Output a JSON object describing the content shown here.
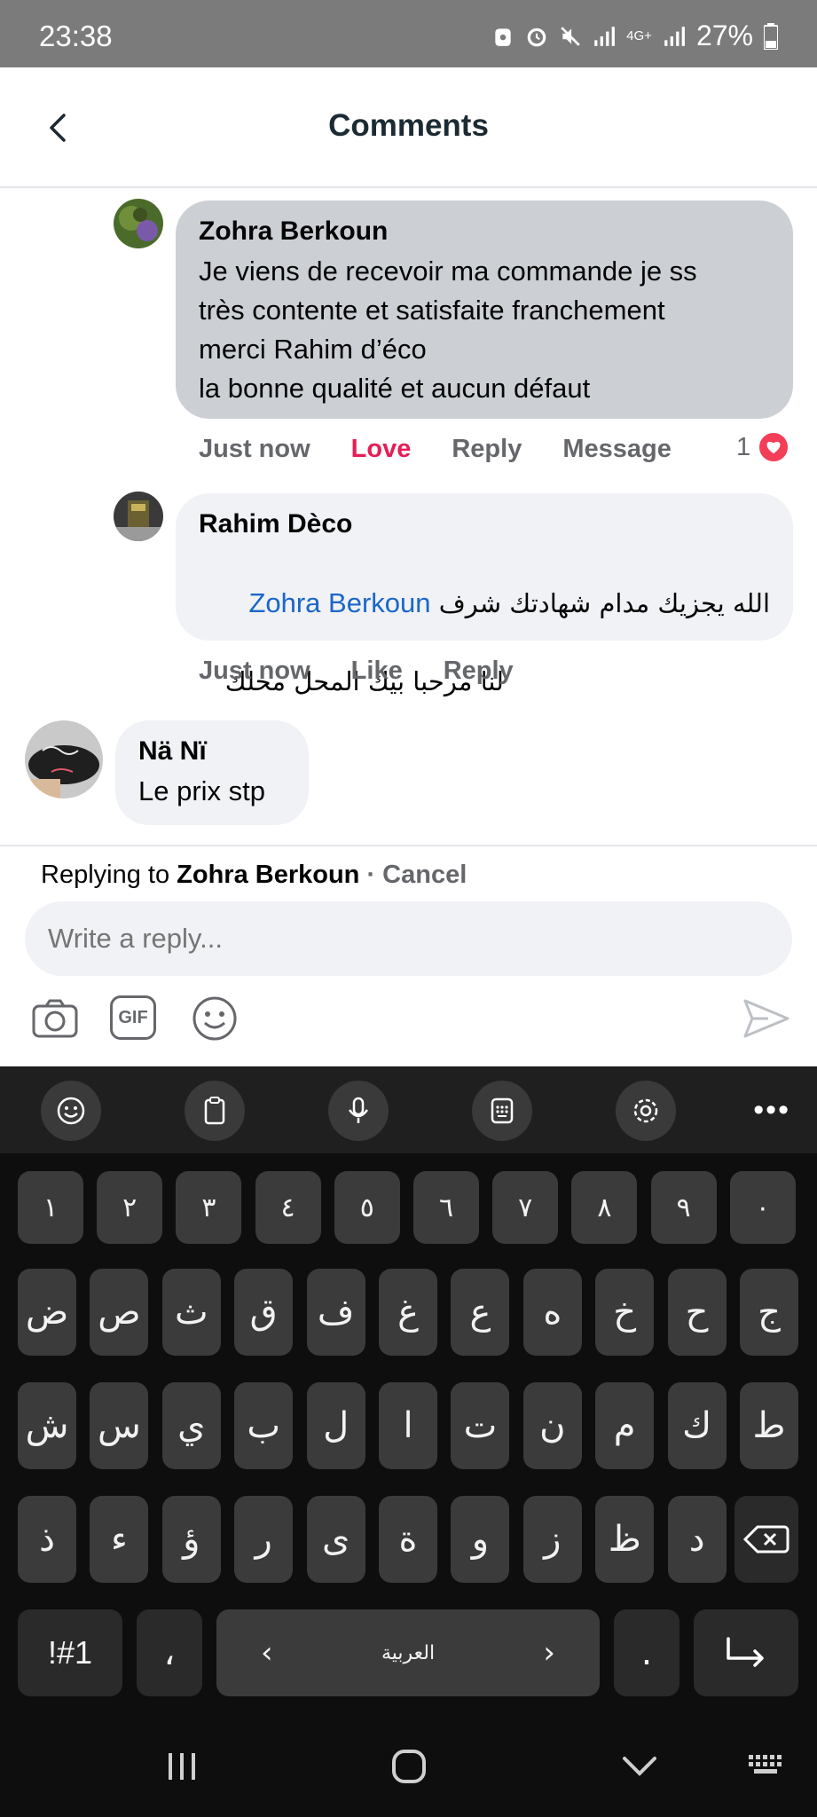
{
  "status_bar": {
    "time": "23:38",
    "network": "4G+",
    "battery": "27%"
  },
  "header": {
    "title": "Comments"
  },
  "comments": [
    {
      "author": "Zohra Berkoun",
      "text": "Je viens de recevoir ma commande je ss\ntrès contente et satisfaite franchement\nmerci Rahim d’éco\nla bonne qualité et aucun défaut",
      "time": "Just now",
      "react_label": "Love",
      "reply_label": "Reply",
      "message_label": "Message",
      "reaction_count": "1"
    },
    {
      "author": "Rahim Dèco",
      "mention": "Zohra Berkoun",
      "text_line1": "الله يجزيك مدام شهادتك شرف",
      "text_line2": "لنا مرحبا بيك المحل محلك",
      "time": "Just now",
      "like_label": "Like",
      "reply_label": "Reply"
    },
    {
      "author": "Nä Nï",
      "text": "Le prix stp"
    }
  ],
  "reply_bar": {
    "replying_prefix": "Replying to",
    "replying_name": "Zohra Berkoun",
    "cancel_label": "· Cancel",
    "placeholder": "Write a reply...",
    "gif_label": "GIF"
  },
  "keyboard": {
    "numbers": [
      "١",
      "٢",
      "٣",
      "٤",
      "٥",
      "٦",
      "٧",
      "٨",
      "٩",
      "٠"
    ],
    "row1": [
      "ض",
      "ص",
      "ث",
      "ق",
      "ف",
      "غ",
      "ع",
      "ه",
      "خ",
      "ح",
      "ج"
    ],
    "row2": [
      "ش",
      "س",
      "ي",
      "ب",
      "ل",
      "ا",
      "ت",
      "ن",
      "م",
      "ك",
      "ط"
    ],
    "row3": [
      "ذ",
      "ء",
      "ؤ",
      "ر",
      "ى",
      "ة",
      "و",
      "ز",
      "ظ",
      "د"
    ],
    "symbols_label": "!#1",
    "comma_label": "،",
    "space_label": "العربية",
    "period_label": "."
  }
}
